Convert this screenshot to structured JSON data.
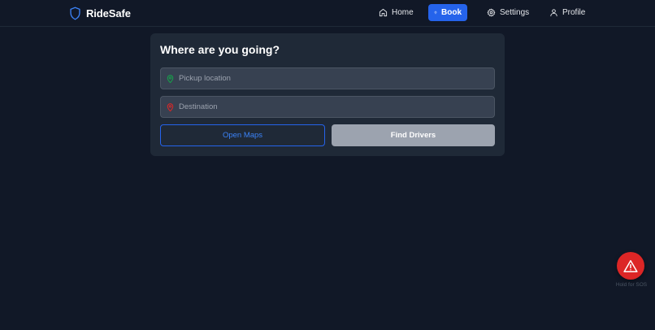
{
  "app": {
    "name": "RideSafe",
    "logo_icon": "shield-icon"
  },
  "nav": {
    "items": [
      {
        "label": "Home",
        "icon": "home-icon",
        "active": false
      },
      {
        "label": "Book",
        "icon": "map-pin-icon",
        "active": true
      },
      {
        "label": "Settings",
        "icon": "gear-icon",
        "active": false
      },
      {
        "label": "Profile",
        "icon": "user-icon",
        "active": false
      }
    ]
  },
  "booking": {
    "title": "Where are you going?",
    "pickup": {
      "placeholder": "Pickup location",
      "value": "",
      "icon": "map-pin-icon",
      "icon_color": "#16a34a"
    },
    "destination": {
      "placeholder": "Destination",
      "value": "",
      "icon": "map-pin-icon",
      "icon_color": "#dc2626"
    },
    "open_maps_label": "Open Maps",
    "find_drivers_label": "Find Drivers"
  },
  "sos": {
    "icon": "alert-triangle-icon",
    "hint": "Hold for SOS",
    "color": "#dc2626"
  },
  "colors": {
    "background": "#111827",
    "card": "#1f2937",
    "accent": "#2563eb"
  }
}
